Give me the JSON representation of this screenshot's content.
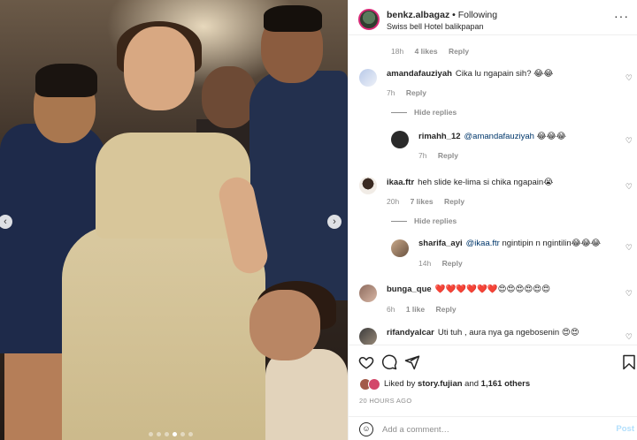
{
  "post": {
    "username": "benkz.albagaz",
    "separator": "•",
    "following": "Following",
    "location": "Swiss bell Hotel balikpapan",
    "more": "···"
  },
  "comments": [
    {
      "id": "c0",
      "meta_time": "18h",
      "meta_likes": "4 likes",
      "meta_reply": "Reply"
    },
    {
      "id": "c1",
      "user": "amandafauziyah",
      "text": "Cika lu ngapain sih? 😂😂",
      "time": "7h",
      "reply": "Reply"
    },
    {
      "id": "h1",
      "hide": "Hide replies"
    },
    {
      "id": "c2",
      "user": "rimahh_12",
      "mention": "@amandafauziyah",
      "text": "😂😂😂",
      "time": "7h",
      "reply": "Reply"
    },
    {
      "id": "c3",
      "user": "ikaa.ftr",
      "text": "heh slide ke-lima si chika ngapain😭",
      "time": "20h",
      "likes": "7 likes",
      "reply": "Reply"
    },
    {
      "id": "h2",
      "hide": "Hide replies"
    },
    {
      "id": "c4",
      "user": "sharifa_ayi",
      "mention": "@ikaa.ftr",
      "text": "ngintipin n ngintilin😂😂😂",
      "time": "14h",
      "reply": "Reply"
    },
    {
      "id": "c5",
      "user": "bunga_que",
      "text": "❤️❤️❤️❤️❤️❤️😍😍😍😍😍😍",
      "time": "6h",
      "likes": "1 like",
      "reply": "Reply"
    },
    {
      "id": "c6",
      "user": "rifandyalcar",
      "text": "Uti tuh , aura nya ga ngebosenin 😍😍"
    }
  ],
  "actions": {
    "liked_prefix": "Liked by",
    "liked_user": "story.fujian",
    "liked_and": "and",
    "liked_others": "1,161 others",
    "posted": "20 HOURS AGO",
    "comment_placeholder": "Add a comment…",
    "post_label": "Post"
  },
  "colors": {
    "accent": "#0095f6",
    "muted": "#8e8e8e",
    "text": "#262626"
  }
}
